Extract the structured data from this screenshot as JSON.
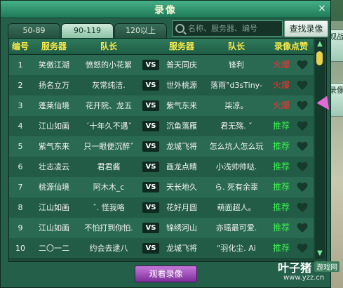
{
  "window": {
    "title": "录像",
    "close_label": "×"
  },
  "side": {
    "btn1": "观战",
    "btn2": "录像"
  },
  "tabs": [
    {
      "label": "50-89"
    },
    {
      "label": "90-119"
    },
    {
      "label": "120以上"
    }
  ],
  "search": {
    "placeholder": "名称、服务器、编号",
    "button_label": "查找录像"
  },
  "table": {
    "headers": [
      "编号",
      "服务器",
      "队长",
      "服务器",
      "队长",
      "录像点赞"
    ],
    "rows": [
      {
        "num": "1",
        "server1": "笑傲江湖",
        "captain1": "愤怒的小花絮",
        "vs": "VS",
        "server2": "普天同庆",
        "captain2": "锋利",
        "status": "火爆",
        "status_type": "fire"
      },
      {
        "num": "2",
        "server1": "扬名立万",
        "captain1": "灰常纯洁.",
        "vs": "VS",
        "server2": "世外桃源",
        "captain2": "落雨°d3sTiny-",
        "status": "火爆",
        "status_type": "fire"
      },
      {
        "num": "3",
        "server1": "蓬莱仙境",
        "captain1": "花开院、龙五",
        "vs": "VS",
        "server2": "紫气东来",
        "captain2": "柒凉。",
        "status": "火爆",
        "status_type": "fire"
      },
      {
        "num": "4",
        "server1": "江山如画",
        "captain1": "ˊ十年久不遇ˇ",
        "vs": "VS",
        "server2": "沉鱼落雁",
        "captain2": "君无殇. ˇ",
        "status": "推荐",
        "status_type": "rec"
      },
      {
        "num": "5",
        "server1": "紫气东来",
        "captain1": "只一眼便沉醉ˇ",
        "vs": "VS",
        "server2": "龙城飞将",
        "captain2": "怎么坑人怎么玩",
        "status": "推荐",
        "status_type": "rec"
      },
      {
        "num": "6",
        "server1": "壮志凌云",
        "captain1": "君君酱",
        "vs": "VS",
        "server2": "画龙点睛",
        "captain2": "小浅帅帅哒.",
        "status": "推荐",
        "status_type": "rec"
      },
      {
        "num": "7",
        "server1": "桃源仙境",
        "captain1": "阿木木_c",
        "vs": "VS",
        "server2": "天长地久",
        "captain2": "ら. 死有余辜",
        "status": "推荐",
        "status_type": "rec"
      },
      {
        "num": "8",
        "server1": "江山如画",
        "captain1": "ˇ. 怪我咯",
        "vs": "VS",
        "server2": "花好月圆",
        "captain2": "萌面超人。",
        "status": "推荐",
        "status_type": "rec"
      },
      {
        "num": "9",
        "server1": "江山如画",
        "captain1": "不怕打到你怕.",
        "vs": "VS",
        "server2": "锦绣河山",
        "captain2": "亦瑶最可爱.",
        "status": "推荐",
        "status_type": "rec"
      },
      {
        "num": "10",
        "server1": "二〇一二",
        "captain1": "约会去逮八",
        "vs": "VS",
        "server2": "龙城飞将",
        "captain2": "\"羽化尘. Ai",
        "status": "推荐",
        "status_type": "rec"
      }
    ]
  },
  "footer": {
    "watch_label": "观看录像"
  },
  "watermark": {
    "main": "叶子猪",
    "badge": "游戏网",
    "url": "www.yzz.cn"
  },
  "colors": {
    "fire": "#ff2f2f",
    "recommend": "#3bf04f",
    "header_text": "#f6e84a"
  }
}
